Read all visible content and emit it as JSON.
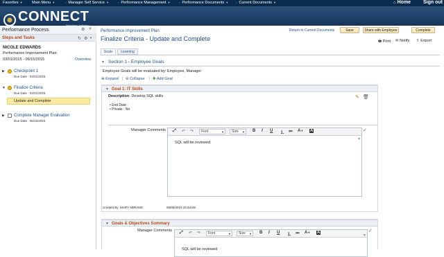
{
  "topnav": {
    "items": [
      "Favorites",
      "Main Menu",
      "Manager Self Service",
      "Performance Management",
      "Performance Documents",
      "Current Documents"
    ],
    "home": "Home",
    "signout": "Sign out"
  },
  "banner": {
    "logo": "CONNECT",
    "subtitle": "Maryland Judiciary"
  },
  "left": {
    "title": "Performance Process",
    "section": "Steps and Tasks",
    "employee": "NICOLE EDWARDS",
    "plan": "Performance Improvement Plan",
    "date_from": "03/01/2015",
    "date_sep": "-",
    "date_to": "06/15/2015",
    "overview": "Overview",
    "steps": [
      {
        "name": "Checkpoint 1",
        "due_label": "Due Date",
        "due": "04/21/2015"
      },
      {
        "name": "Finalize Criteria",
        "due_label": "Due Date",
        "due": "04/21/2015",
        "action": "Update and Complete"
      },
      {
        "name": "Complete Manager Evaluation",
        "due_label": "Due Date",
        "due": "06/15/2015"
      }
    ]
  },
  "main": {
    "doc_type": "Performance Improvement Plan",
    "title": "Finalize Criteria - Update and Complete",
    "return_link": "Return to Current Documents",
    "buttons": {
      "save": "Save",
      "share": "Share with Employee",
      "complete": "Complete"
    },
    "print": "Print",
    "notify": "Notify",
    "export": "Export",
    "tabs": [
      "Goals",
      "Learning"
    ],
    "section1": "Section 1 - Employee Goals",
    "evaluated_by": "Employee Goals will be evaluated by: Employee, Manager",
    "expand": "Expand",
    "collapse": "Collapse",
    "add_goal": "Add Goal",
    "goal": {
      "header": "Goal 1: IT Skills",
      "desc_label": "Description",
      "desc": ": Develop SQL skills",
      "end_date": "End Date :",
      "private": "Private : No",
      "comments_label": "Manager Comments",
      "comment_text": "SQL will be reviewed",
      "created_by_label": "Created By",
      "created_by": "MARY ABRAMS",
      "created_at": "05/05/2015 10:34AM"
    },
    "summary": {
      "header": "Goals & Objectives Summary",
      "comments_label": "Manager Comments",
      "comment_text": "SQL will be reviewed"
    },
    "editor": {
      "font": "Font",
      "size": "Size",
      "bold": "B",
      "italic": "I",
      "underline": "U",
      "textcolor": "A"
    }
  }
}
